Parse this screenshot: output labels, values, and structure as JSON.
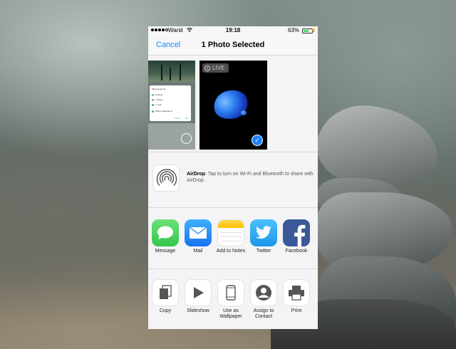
{
  "status_bar": {
    "carrier": "Warid",
    "time": "19:18",
    "battery_percent": "63%",
    "battery_level": 0.63,
    "signal_bars": 4
  },
  "nav": {
    "cancel_label": "Cancel",
    "title": "1 Photo Selected"
  },
  "photos": {
    "live_label": "LIVE",
    "thumb1": {
      "dialog_title": "Mute group for...",
      "options": [
        "8 Hours",
        "1 Week",
        "1 Year"
      ],
      "show_notifications": "Show notifications",
      "cancel": "Cancel",
      "ok": "OK"
    }
  },
  "airdrop": {
    "title": "AirDrop",
    "description": ". Tap to turn on Wi-Fi and Bluetooth to share with AirDrop."
  },
  "share_apps": [
    {
      "label": "Message",
      "icon": "message-icon",
      "color": "#4cd964"
    },
    {
      "label": "Mail",
      "icon": "mail-icon",
      "color": "#1e8ff8"
    },
    {
      "label": "Add to Notes",
      "icon": "notes-icon",
      "color": "#ffcc00"
    },
    {
      "label": "Twitter",
      "icon": "twitter-icon",
      "color": "#1da1f2"
    },
    {
      "label": "Facebook",
      "icon": "facebook-icon",
      "color": "#3b5998"
    }
  ],
  "actions": [
    {
      "label": "Copy",
      "icon": "copy-icon"
    },
    {
      "label": "Slideshow",
      "icon": "slideshow-icon"
    },
    {
      "label": "Use as Wallpaper",
      "icon": "wallpaper-icon"
    },
    {
      "label": "Assign to Contact",
      "icon": "contact-icon"
    },
    {
      "label": "Print",
      "icon": "print-icon"
    }
  ],
  "colors": {
    "accent": "#1a82fb",
    "sheet_bg": "#f4f4f6"
  }
}
